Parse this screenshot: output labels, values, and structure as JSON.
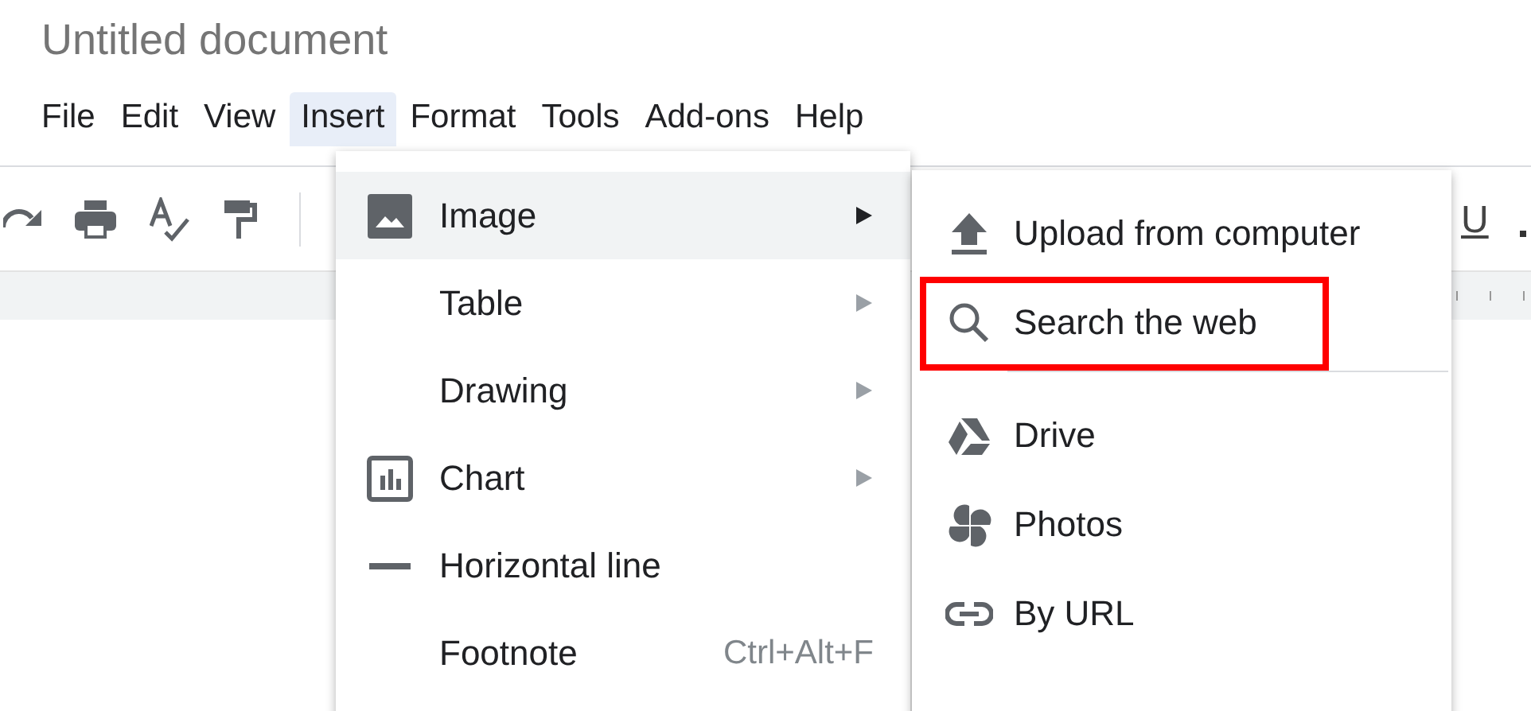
{
  "document": {
    "title": "Untitled document"
  },
  "menu_bar": [
    {
      "label": "File",
      "selected": false
    },
    {
      "label": "Edit",
      "selected": false
    },
    {
      "label": "View",
      "selected": false
    },
    {
      "label": "Insert",
      "selected": true
    },
    {
      "label": "Format",
      "selected": false
    },
    {
      "label": "Tools",
      "selected": false
    },
    {
      "label": "Add-ons",
      "selected": false
    },
    {
      "label": "Help",
      "selected": false
    }
  ],
  "toolbar": {
    "underline_label": "U"
  },
  "insert_menu": [
    {
      "label": "Image",
      "selected": true,
      "has_submenu": true
    },
    {
      "label": "Table",
      "selected": false,
      "has_submenu": true
    },
    {
      "label": "Drawing",
      "selected": false,
      "has_submenu": true
    },
    {
      "label": "Chart",
      "selected": false,
      "has_submenu": true
    },
    {
      "label": "Horizontal line",
      "selected": false,
      "has_submenu": false
    },
    {
      "label": "Footnote",
      "selected": false,
      "has_submenu": false,
      "shortcut": "Ctrl+Alt+F"
    }
  ],
  "image_submenu": [
    {
      "label": "Upload from computer",
      "highlighted": false
    },
    {
      "label": "Search the web",
      "highlighted": true
    },
    {
      "label": "Drive",
      "highlighted": false
    },
    {
      "label": "Photos",
      "highlighted": false
    },
    {
      "label": "By URL",
      "highlighted": false
    }
  ]
}
